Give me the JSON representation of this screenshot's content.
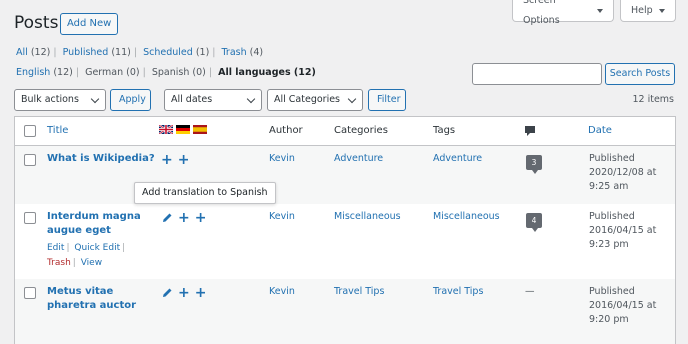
{
  "header": {
    "title": "Posts",
    "add_new": "Add New",
    "screen_options": "Screen Options",
    "help": "Help"
  },
  "status_filters": [
    {
      "label": "All",
      "count": "(12)"
    },
    {
      "label": "Published",
      "count": "(11)"
    },
    {
      "label": "Scheduled",
      "count": "(1)"
    },
    {
      "label": "Trash",
      "count": "(4)"
    }
  ],
  "language_filters": [
    {
      "label": "English",
      "count": "(12)"
    },
    {
      "label": "German",
      "count": "(0)"
    },
    {
      "label": "Spanish",
      "count": "(0)"
    },
    {
      "label": "All languages",
      "count": "(12)"
    }
  ],
  "search": {
    "button": "Search Posts",
    "value": ""
  },
  "toolbar": {
    "bulk_actions": "Bulk actions",
    "apply": "Apply",
    "dates": "All dates",
    "categories": "All Categories",
    "filter": "Filter",
    "items_count": "12 items"
  },
  "columns": {
    "title": "Title",
    "author": "Author",
    "categories": "Categories",
    "tags": "Tags",
    "comments_icon": "comment-icon",
    "date": "Date"
  },
  "flags": [
    "flag-uk",
    "flag-germany",
    "flag-spain"
  ],
  "tooltip": "Add translation to Spanish",
  "row_actions": {
    "edit": "Edit",
    "quick_edit": "Quick Edit",
    "trash": "Trash",
    "view": "View"
  },
  "rows": [
    {
      "title_line1": "What is Wikipedia?",
      "title_line2": "",
      "author": "Kevin",
      "category": "Adventure",
      "tag": "Adventure",
      "comments": "3",
      "date_status": "Published",
      "date_day": "2020/12/08 at",
      "date_time": "9:25 am"
    },
    {
      "title_line1": "Interdum magna",
      "title_line2": "augue eget",
      "author": "Kevin",
      "category": "Miscellaneous",
      "tag": "Miscellaneous",
      "comments": "4",
      "date_status": "Published",
      "date_day": "2016/04/15 at",
      "date_time": "9:23 pm"
    },
    {
      "title_line1": "Metus vitae",
      "title_line2": "pharetra auctor",
      "author": "Kevin",
      "category": "Travel Tips",
      "tag": "Travel Tips",
      "comments": "—",
      "date_status": "Published",
      "date_day": "2016/04/15 at",
      "date_time": "9:20 pm"
    }
  ],
  "colors": {
    "link": "#2271b1",
    "trash": "#b32d2e",
    "bubble": "#646970"
  }
}
